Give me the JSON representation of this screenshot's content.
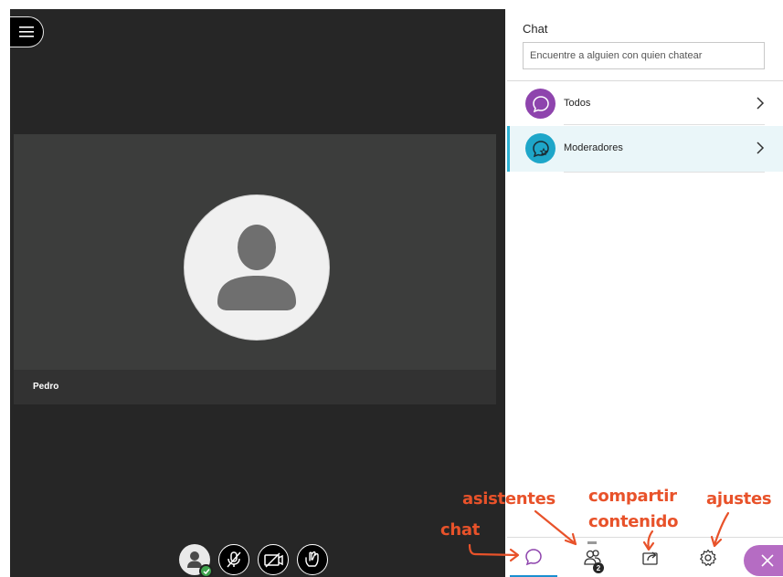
{
  "menu": {
    "icon": "hamburger-icon"
  },
  "video": {
    "participant_name": "Pedro",
    "avatar_icon": "user-silhouette-icon"
  },
  "controls": [
    {
      "name": "my-status",
      "icon": "user-check-icon"
    },
    {
      "name": "microphone",
      "icon": "mic-off-icon"
    },
    {
      "name": "camera",
      "icon": "camera-off-icon"
    },
    {
      "name": "raise-hand",
      "icon": "hand-icon"
    }
  ],
  "chat": {
    "title": "Chat",
    "search_placeholder": "Encuentre a alguien con quien chatear",
    "channels": [
      {
        "label": "Todos",
        "color": "#8e44ad",
        "icon": "chat-bubble-icon",
        "active": false
      },
      {
        "label": "Moderadores",
        "color": "#1ea6c9",
        "icon": "chat-bubble-star-icon",
        "active": true
      }
    ]
  },
  "bottom_bar": {
    "items": [
      {
        "name": "chat",
        "icon": "chat-bubble-icon",
        "selected": true
      },
      {
        "name": "attendees",
        "icon": "attendees-icon",
        "count": "2"
      },
      {
        "name": "share-content",
        "icon": "share-icon"
      },
      {
        "name": "settings",
        "icon": "gear-icon"
      },
      {
        "name": "close",
        "icon": "close-icon"
      }
    ]
  },
  "annotations": {
    "asistentes": "asistentes",
    "compartir": "compartir",
    "contenido": "contenido",
    "ajustes": "ajustes",
    "chat": "chat",
    "color": "#e8522a"
  }
}
